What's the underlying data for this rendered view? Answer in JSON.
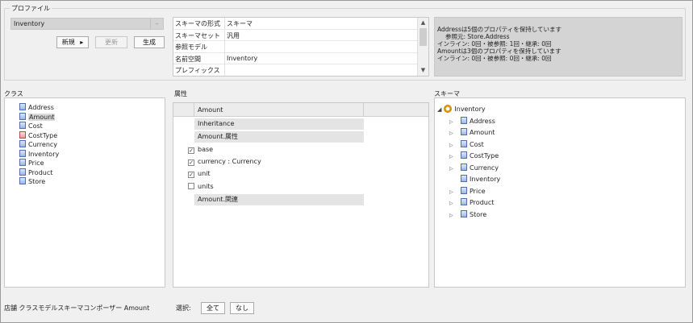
{
  "profile": {
    "group_label": "プロファイル",
    "selected": "Inventory",
    "buttons": {
      "new": "新規",
      "new_arrow": "▸",
      "update": "更新",
      "generate": "生成"
    }
  },
  "properties": [
    {
      "key": "スキーマの形式",
      "value": "スキーマ"
    },
    {
      "key": "スキーマセット",
      "value": "汎用"
    },
    {
      "key": "参照モデル",
      "value": ""
    },
    {
      "key": "名前空間",
      "value": "Inventory"
    },
    {
      "key": "プレフィックス",
      "value": ""
    }
  ],
  "info_lines": [
    "Addressは5個のプロパティを保持しています",
    "参照元: Store.Address",
    "インライン: 0回・被参照: 1回・継承: 0回",
    "Amountは3個のプロパティを保持しています",
    "インライン: 0回・被参照: 0回・継承: 0回"
  ],
  "classes": {
    "title": "クラス",
    "items": [
      {
        "label": "Address",
        "selected": false,
        "red": false
      },
      {
        "label": "Amount",
        "selected": true,
        "red": false
      },
      {
        "label": "Cost",
        "selected": false,
        "red": false
      },
      {
        "label": "CostType",
        "selected": false,
        "red": true
      },
      {
        "label": "Currency",
        "selected": false,
        "red": false
      },
      {
        "label": "Inventory",
        "selected": false,
        "red": false
      },
      {
        "label": "Price",
        "selected": false,
        "red": false
      },
      {
        "label": "Product",
        "selected": false,
        "red": false
      },
      {
        "label": "Store",
        "selected": false,
        "red": false
      }
    ]
  },
  "attributes": {
    "title": "属性",
    "header": "Amount",
    "inheritance": "Inheritance",
    "attr_band": "Amount.属性",
    "rows": [
      {
        "label": "base",
        "checked": true
      },
      {
        "label": "currency : Currency",
        "checked": true
      },
      {
        "label": "unit",
        "checked": true
      },
      {
        "label": "units",
        "checked": false
      }
    ],
    "rel_band": "Amount.関連"
  },
  "schema": {
    "title": "スキーマ",
    "root": "Inventory",
    "children": [
      {
        "label": "Address",
        "expandable": true
      },
      {
        "label": "Amount",
        "expandable": true
      },
      {
        "label": "Cost",
        "expandable": true
      },
      {
        "label": "CostType",
        "expandable": true
      },
      {
        "label": "Currency",
        "expandable": true
      },
      {
        "label": "Inventory",
        "expandable": false
      },
      {
        "label": "Price",
        "expandable": true
      },
      {
        "label": "Product",
        "expandable": true
      },
      {
        "label": "Store",
        "expandable": true
      }
    ]
  },
  "footer": {
    "status": "店舗 クラスモデルスキーマコンポーザー Amount",
    "select_label": "選択:",
    "all_button": "全て",
    "none_button": "なし"
  },
  "icons": {
    "dropdown": "chevron-down-icon",
    "class": "class-icon",
    "root": "schema-root-icon"
  }
}
